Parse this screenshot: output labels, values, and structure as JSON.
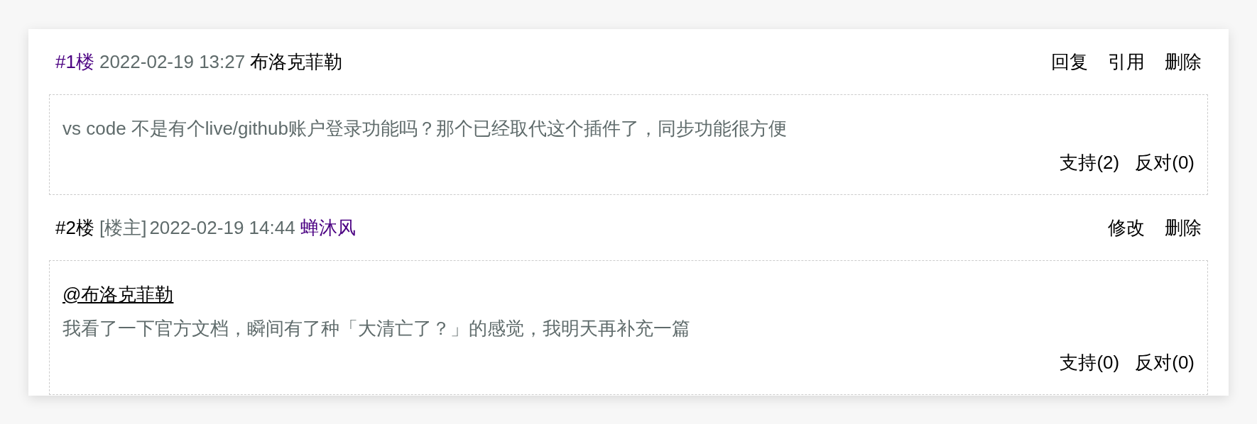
{
  "comments": [
    {
      "header": [
        {
          "kind": "floor",
          "text": "#1楼",
          "color": "#4b0082"
        },
        {
          "kind": "date",
          "text": "2022-02-19 13:27",
          "color": "#5f6b6b"
        },
        {
          "kind": "author",
          "text": "布洛克菲勒",
          "color": "#000000"
        }
      ],
      "actions": [
        "回复",
        "引用",
        "删除"
      ],
      "body": "vs code 不是有个live/github账户登录功能吗？那个已经取代这个插件了，同步功能很方便",
      "votes": [
        "支持(2)",
        "反对(0)"
      ]
    },
    {
      "header": [
        {
          "kind": "floor",
          "text": "#2楼",
          "color": "#000000"
        },
        {
          "kind": "tag",
          "text": "[楼主]",
          "color": "#5f6b6b"
        },
        {
          "kind": "date",
          "text": "2022-02-19 14:44",
          "color": "#5f6b6b"
        },
        {
          "kind": "author",
          "text": "蝉沐风",
          "color": "#4b0082"
        }
      ],
      "actions": [
        "修改",
        "删除"
      ],
      "mention": "@布洛克菲勒",
      "body": "我看了一下官方文档，瞬间有了种「大清亡了？」的感觉，我明天再补充一篇",
      "votes": [
        "支持(0)",
        "反对(0)"
      ]
    }
  ]
}
